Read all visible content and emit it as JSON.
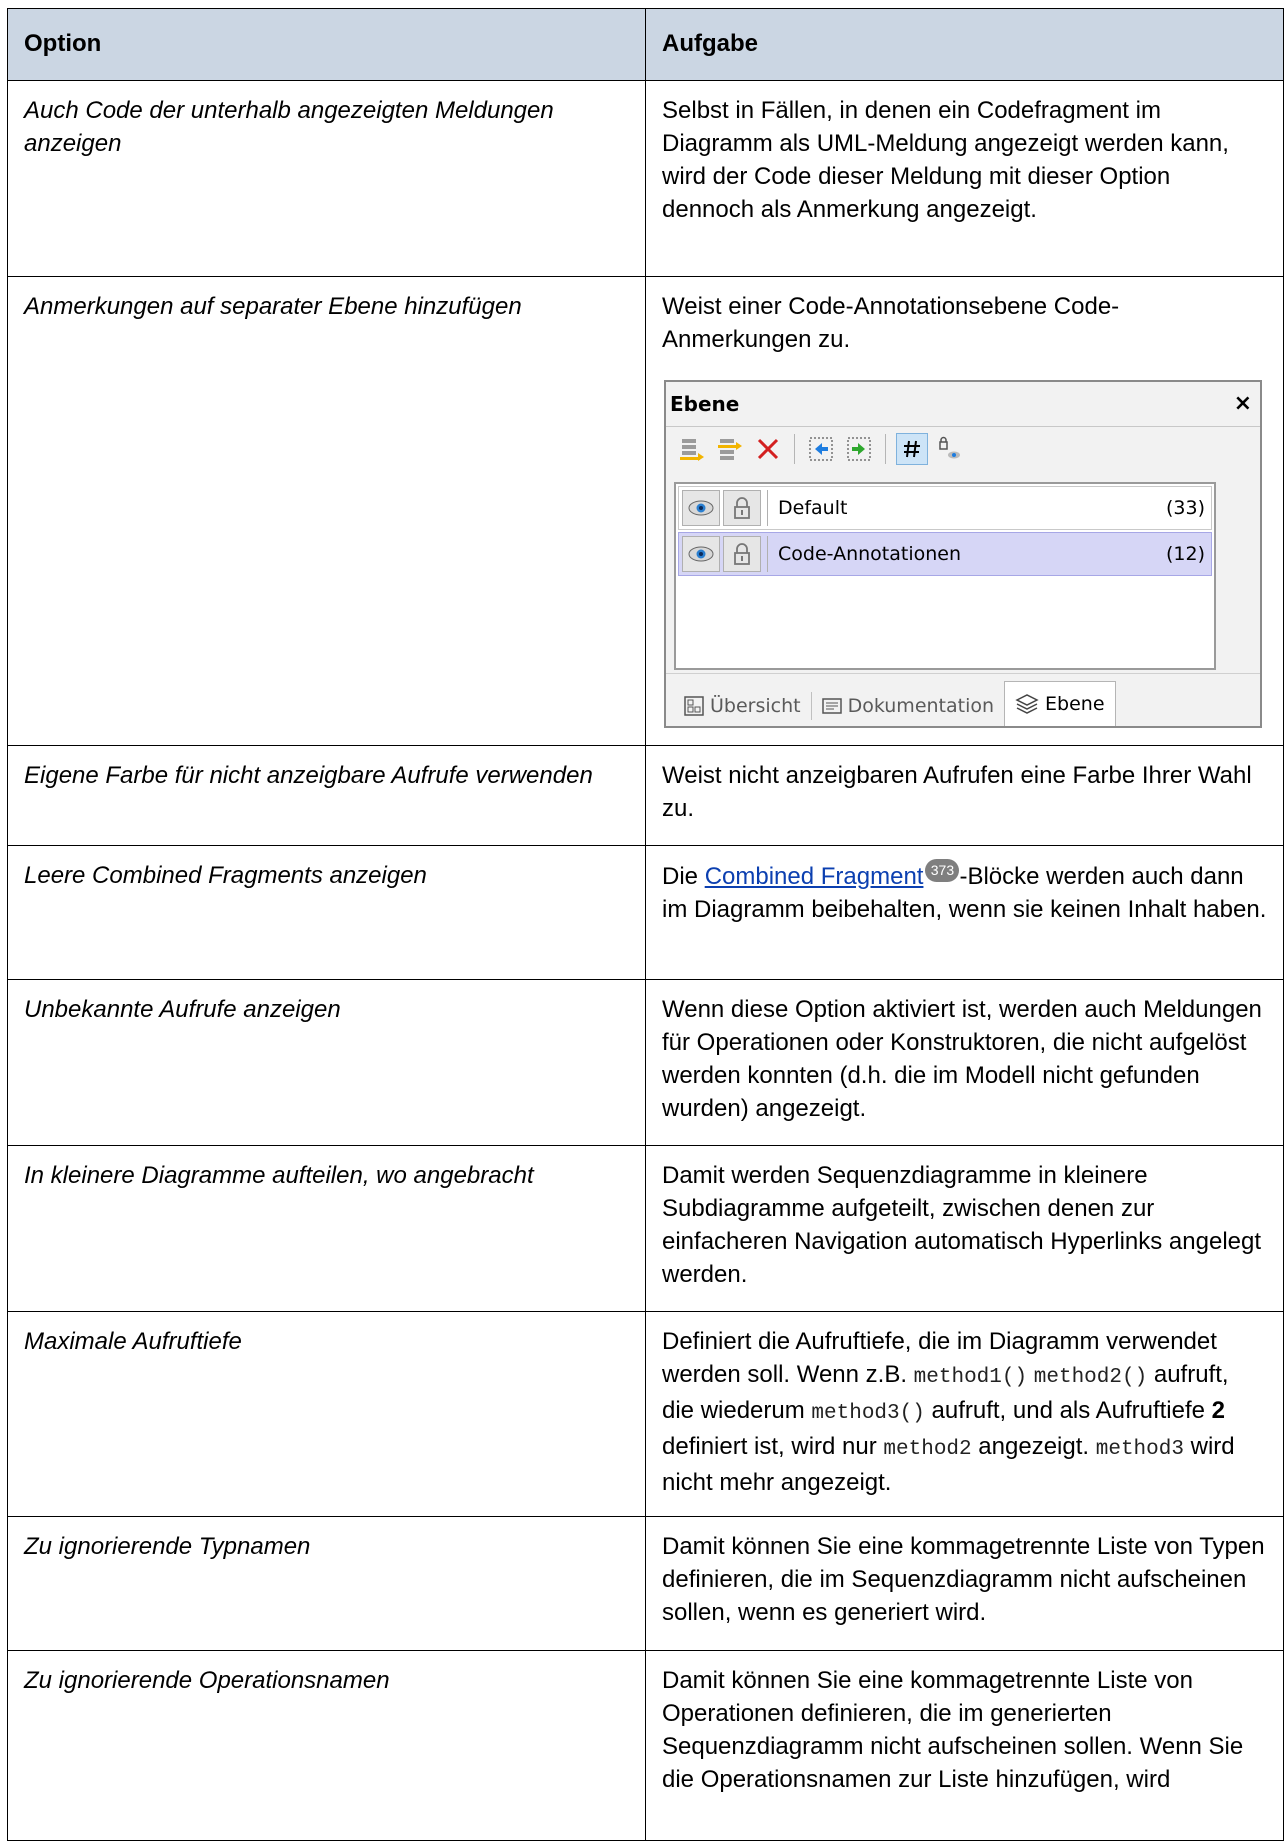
{
  "table": {
    "header": {
      "option": "Option",
      "task": "Aufgabe"
    },
    "rows": [
      {
        "option": "Auch Code der unterhalb angezeigten Meldungen anzeigen",
        "task": "Selbst in Fällen, in denen ein Codefragment im Diagramm als UML-Meldung angezeigt werden kann, wird der Code dieser Meldung mit dieser Option dennoch als Anmerkung angezeigt."
      },
      {
        "option": "Anmerkungen auf separater Ebene hinzufügen",
        "task": "Weist einer Code-Annotationsebene Code-Anmerkungen zu."
      },
      {
        "option": "Eigene Farbe für nicht anzeigbare Aufrufe verwenden",
        "task": "Weist nicht anzeigbaren Aufrufen eine Farbe Ihrer Wahl zu."
      },
      {
        "option": "Leere Combined Fragments anzeigen",
        "task_link": "Combined Fragment",
        "task_badge": "373",
        "task_after": "-Blöcke werden auch dann im Diagramm beibehalten, wenn sie keinen Inhalt haben.",
        "task_before": "Die "
      },
      {
        "option": "Unbekannte Aufrufe anzeigen",
        "task": "Wenn diese Option aktiviert ist, werden auch Meldungen für Operationen oder Konstruktoren, die nicht aufgelöst werden konnten (d.h. die im Modell nicht gefunden wurden) angezeigt."
      },
      {
        "option": "In kleinere Diagramme aufteilen, wo angebracht",
        "task": "Damit werden Sequenzdiagramme in kleinere Subdiagramme aufgeteilt, zwischen denen zur einfacheren Navigation automatisch Hyperlinks angelegt werden."
      },
      {
        "option": "Maximale Aufruftiefe",
        "task_parts": [
          "Definiert die Aufruftiefe, die im Diagramm verwendet werden soll. Wenn z.B. ",
          "method1()",
          " ",
          "method2()",
          " aufruft, die wiederum ",
          "method3()",
          " aufruft, und als Aufruftiefe ",
          "2",
          " definiert ist, wird nur ",
          "method2",
          " angezeigt. ",
          "method3",
          " wird nicht mehr angezeigt."
        ]
      },
      {
        "option": "Zu ignorierende Typnamen",
        "task": "Damit können Sie eine kommagetrennte Liste von Typen definieren, die im Sequenzdiagramm nicht aufscheinen sollen, wenn es generiert wird."
      },
      {
        "option": "Zu ignorierende Operationsnamen",
        "task": "Damit können Sie eine kommagetrennte Liste von Operationen definieren, die im generierten Sequenzdiagramm nicht aufscheinen sollen. Wenn Sie die Operationsnamen zur Liste hinzufügen, wird"
      }
    ]
  },
  "layers_panel": {
    "title": "Ebene",
    "close_glyph": "×",
    "toolbar_icons": [
      "add-layer-icon",
      "insert-layer-icon",
      "delete-layer-icon",
      "move-left-icon",
      "move-right-icon",
      "grid-icon",
      "lock-view-icon"
    ],
    "layers": [
      {
        "name": "Default",
        "count": "(33)",
        "selected": false
      },
      {
        "name": "Code-Annotationen",
        "count": "(12)",
        "selected": true
      }
    ],
    "tabs": [
      {
        "label": "Übersicht",
        "active": false
      },
      {
        "label": "Dokumentation",
        "active": false
      },
      {
        "label": "Ebene",
        "active": true
      }
    ]
  }
}
